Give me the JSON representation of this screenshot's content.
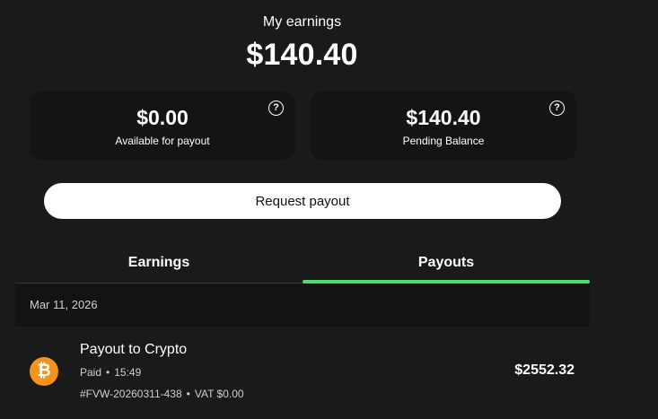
{
  "header": {
    "title": "My earnings",
    "total": "$140.40"
  },
  "cards": {
    "available": {
      "amount": "$0.00",
      "label": "Available for payout",
      "help_icon": "?"
    },
    "pending": {
      "amount": "$140.40",
      "label": "Pending Balance",
      "help_icon": "?"
    }
  },
  "request_payout_label": "Request payout",
  "tabs": {
    "earnings": "Earnings",
    "payouts": "Payouts",
    "active": "payouts",
    "accent_color": "#4ade6b"
  },
  "payouts": {
    "date": "Mar 11, 2026",
    "item": {
      "icon": "bitcoin-icon",
      "icon_glyph": "₿",
      "icon_color": "#f7931a",
      "title": "Payout to Crypto",
      "status": "Paid",
      "time": "15:49",
      "reference": "#FVW-20260311-438",
      "vat": "VAT $0.00",
      "amount": "$2552.32",
      "separator": "•"
    }
  }
}
